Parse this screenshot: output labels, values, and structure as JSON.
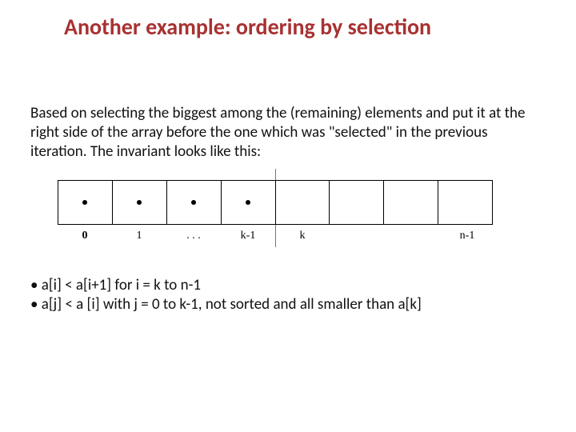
{
  "title": "Another example: ordering by selection",
  "intro": "Based on selecting the biggest among the (remaining) elements and put it at the right side of the array before the one which was \"selected\" in the previous iteration. The invariant looks like this:",
  "labels": {
    "l0": "0",
    "l1": "1",
    "ldots": ". . .",
    "lkm1": "k-1",
    "lk": "k",
    "lnm1": "n-1"
  },
  "bullet1": "• a[i] < a[i+1]  for i = k to n-1",
  "bullet2": "• a[j] < a [i] with j = 0 to k-1, not sorted and all smaller than a[k]"
}
